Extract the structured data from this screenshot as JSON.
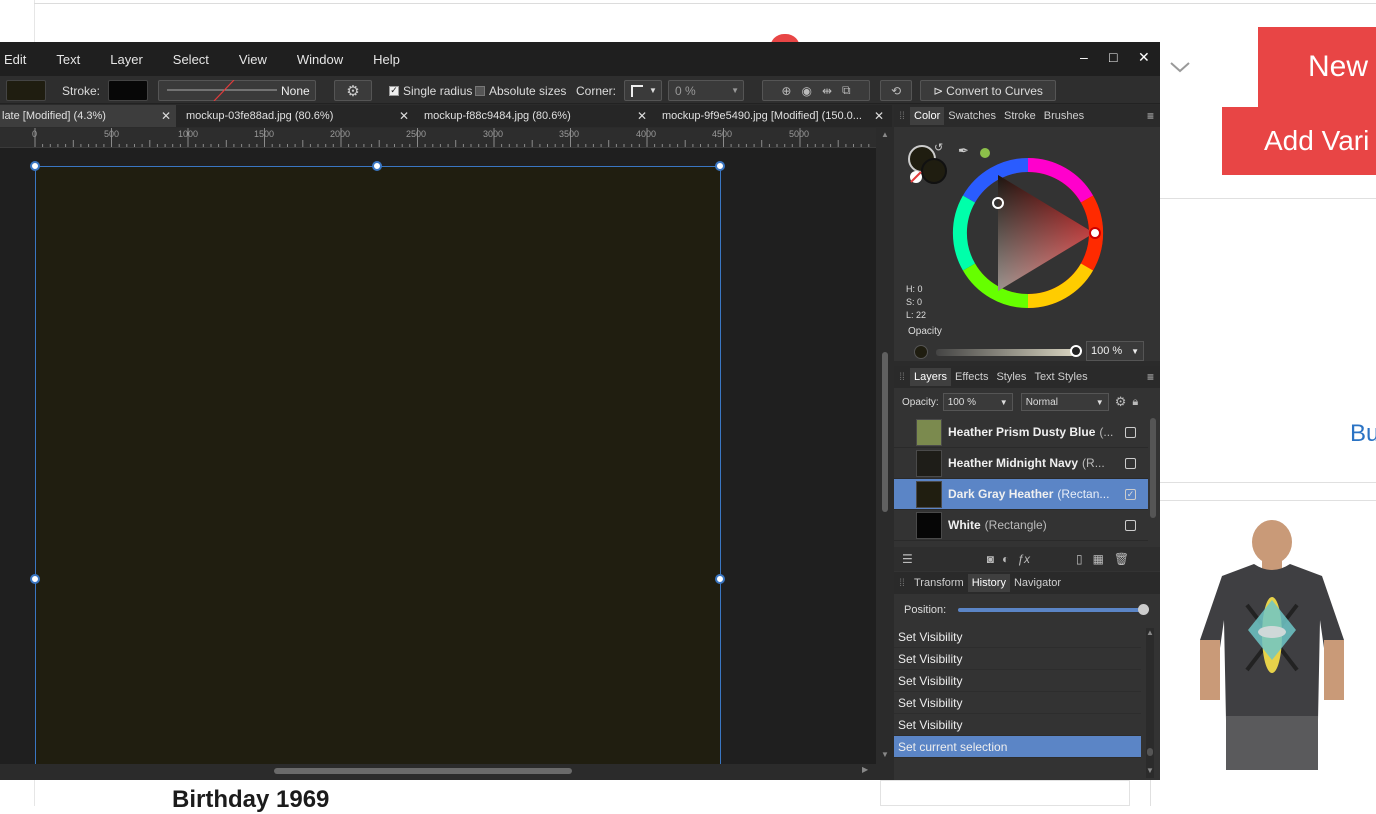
{
  "background_page": {
    "new_button": "New",
    "add_variant_button": "Add Vari",
    "link_fragment": "Bu",
    "product_title_fragment": "Birthday 1969"
  },
  "app": {
    "menu": [
      "Edit",
      "Text",
      "Layer",
      "Select",
      "View",
      "Window",
      "Help"
    ],
    "window_controls": {
      "minimize": "–",
      "maximize": "□",
      "close": "✕"
    },
    "toolbar": {
      "stroke_label": "Stroke:",
      "stroke_style": "None",
      "single_radius": "Single radius",
      "single_radius_checked": true,
      "absolute_sizes": "Absolute sizes",
      "absolute_sizes_checked": false,
      "corner_label": "Corner:",
      "corner_value": "0 %",
      "convert_to_curves": "Convert to Curves",
      "fill_color": "#1f1d10",
      "stroke_color": "#070707"
    },
    "document_tabs": [
      {
        "label": "late [Modified] (4.3%)",
        "active": true
      },
      {
        "label": "mockup-03fe88ad.jpg (80.6%)",
        "active": false
      },
      {
        "label": "mockup-f88c9484.jpg (80.6%)",
        "active": false
      },
      {
        "label": "mockup-9f9e5490.jpg [Modified] (150.0...",
        "active": false
      }
    ],
    "ruler_labels": [
      "0",
      "500",
      "1000",
      "1500",
      "2000",
      "2500",
      "3000",
      "3500",
      "4000",
      "4500",
      "5000"
    ],
    "artboard_color": "#201e10",
    "selection_color": "#3a76c2"
  },
  "color_panel": {
    "tabs": [
      "Color",
      "Swatches",
      "Stroke",
      "Brushes"
    ],
    "active_tab": "Color",
    "h": "H: 0",
    "s": "S: 0",
    "l": "L: 22",
    "opacity_label": "Opacity",
    "opacity_value": "100 %"
  },
  "layers_panel": {
    "tabs": [
      "Layers",
      "Effects",
      "Styles",
      "Text Styles"
    ],
    "active_tab": "Layers",
    "opacity_label": "Opacity:",
    "opacity_value": "100 %",
    "blend_mode": "Normal",
    "layers": [
      {
        "name": "Heather  Prism Dusty Blue",
        "type": "(...",
        "thumb": "#7b8a4e",
        "selected": false,
        "visible": false
      },
      {
        "name": "Heather  Midnight Navy",
        "type": "(R...",
        "thumb": "#1e1d18",
        "selected": false,
        "visible": false
      },
      {
        "name": "Dark Gray Heather",
        "type": "(Rectan...",
        "thumb": "#201e10",
        "selected": true,
        "visible": true
      },
      {
        "name": "White",
        "type": "(Rectangle)",
        "thumb": "#060606",
        "selected": false,
        "visible": false
      }
    ]
  },
  "history_panel": {
    "tabs": [
      "Transform",
      "History",
      "Navigator"
    ],
    "active_tab": "History",
    "position_label": "Position:",
    "entries": [
      "Set Visibility",
      "Set Visibility",
      "Set Visibility",
      "Set Visibility",
      "Set Visibility",
      "Set current selection"
    ],
    "selected_index": 5
  }
}
